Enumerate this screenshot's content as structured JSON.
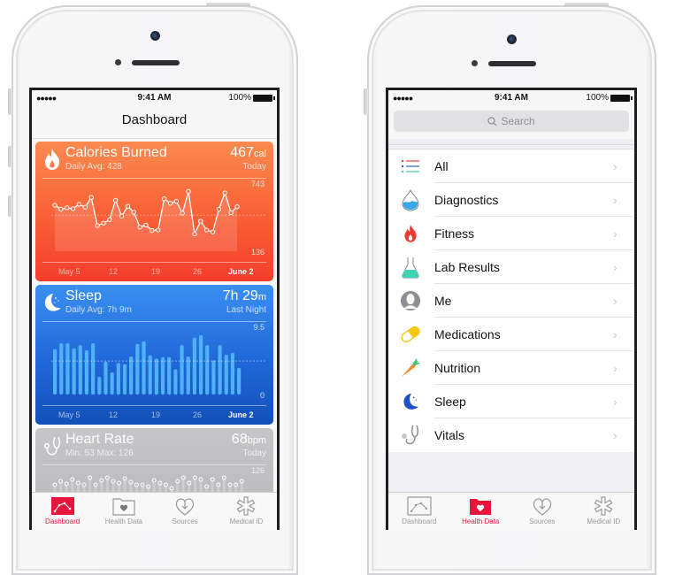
{
  "status_bar": {
    "signal": "●●●●●",
    "time": "9:41 AM",
    "battery": "100%"
  },
  "dashboard": {
    "title": "Dashboard",
    "cards": {
      "calories": {
        "title": "Calories Burned",
        "subtitle": "Daily Avg: 428",
        "value": "467",
        "unit": "cal",
        "value_sub": "Today",
        "ymax": "743",
        "ymin": "136",
        "color": "#f95f35"
      },
      "sleep": {
        "title": "Sleep",
        "subtitle": "Daily Avg: 7h 9m",
        "value": "7h 29",
        "unit": "m",
        "value_sub": "Last Night",
        "ymax": "9.5",
        "ymin": "0",
        "color": "#2067d8"
      },
      "heart": {
        "title": "Heart Rate",
        "subtitle": "Min: 53 Max: 126",
        "value": "68",
        "unit": "bpm",
        "value_sub": "Today",
        "ymax": "126"
      }
    },
    "x_labels": [
      "May 5",
      "12",
      "19",
      "26",
      "June 2"
    ]
  },
  "health_data": {
    "search_placeholder": "Search",
    "items": [
      {
        "label": "All",
        "icon": "list-icon"
      },
      {
        "label": "Diagnostics",
        "icon": "water-drop-icon"
      },
      {
        "label": "Fitness",
        "icon": "flame-icon"
      },
      {
        "label": "Lab Results",
        "icon": "flask-icon"
      },
      {
        "label": "Me",
        "icon": "person-icon"
      },
      {
        "label": "Medications",
        "icon": "pill-icon"
      },
      {
        "label": "Nutrition",
        "icon": "carrot-icon"
      },
      {
        "label": "Sleep",
        "icon": "moon-icon"
      },
      {
        "label": "Vitals",
        "icon": "stethoscope-icon"
      }
    ],
    "chevron": "›"
  },
  "tabbar": {
    "tabs": [
      {
        "label": "Dashboard",
        "icon": "chart-icon"
      },
      {
        "label": "Health Data",
        "icon": "folder-heart-icon"
      },
      {
        "label": "Sources",
        "icon": "heart-download-icon"
      },
      {
        "label": "Medical ID",
        "icon": "asterisk-icon"
      }
    ],
    "active_color": "#e5163d"
  },
  "chart_data": [
    {
      "type": "line",
      "title": "Calories Burned",
      "x": [
        "May 5",
        "",
        "",
        "",
        "",
        "",
        "",
        "12",
        "",
        "",
        "",
        "",
        "",
        "",
        "19",
        "",
        "",
        "",
        "",
        "",
        "",
        "26",
        "",
        "",
        "",
        "",
        "",
        "",
        "June 2",
        "",
        ""
      ],
      "values": [
        600,
        560,
        575,
        565,
        610,
        580,
        680,
        395,
        420,
        455,
        650,
        490,
        590,
        530,
        380,
        400,
        345,
        350,
        665,
        620,
        640,
        520,
        740,
        310,
        440,
        350,
        330,
        560,
        725,
        525,
        585
      ],
      "ylim": [
        136,
        743
      ],
      "average": 500,
      "tick_labels": [
        "May 5",
        "12",
        "19",
        "26",
        "June 2"
      ]
    },
    {
      "type": "bar",
      "title": "Sleep",
      "values": [
        7.2,
        8.1,
        8.1,
        7.3,
        7.8,
        7.0,
        8.1,
        2.8,
        5.2,
        3.5,
        5.0,
        4.8,
        6.0,
        8.0,
        8.4,
        6.2,
        5.7,
        5.9,
        5.9,
        4.0,
        7.8,
        6.0,
        9.0,
        9.4,
        7.8,
        5.4,
        7.8,
        6.3,
        6.6,
        4.2
      ],
      "ylim": [
        0,
        9.5
      ],
      "average": 5.3,
      "tick_labels": [
        "May 5",
        "12",
        "19",
        "26",
        "June 2"
      ]
    }
  ]
}
